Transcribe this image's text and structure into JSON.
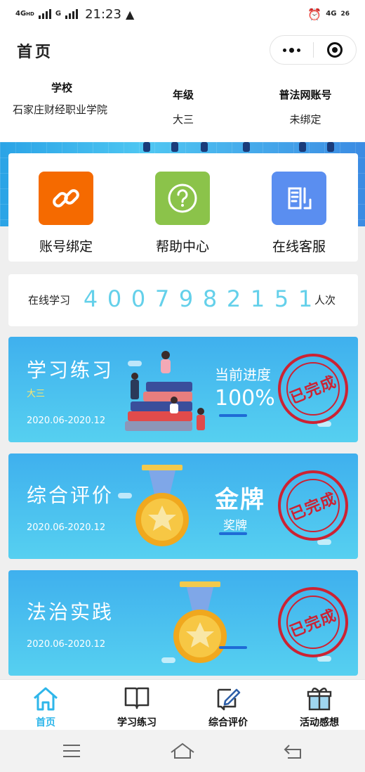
{
  "status": {
    "net_left_1": "4G",
    "net_left_1_sup": "HD",
    "net_left_2": "G",
    "time": "21:23",
    "net_right": "4G",
    "battery": "26"
  },
  "nav": {
    "title": "首页"
  },
  "info": {
    "school_label": "学校",
    "school_value": "石家庄财经职业学院",
    "grade_label": "年级",
    "grade_value": "大三",
    "account_label": "普法网账号",
    "account_value": "未绑定"
  },
  "menu": {
    "bind_label": "账号绑定",
    "help_label": "帮助中心",
    "service_label": "在线客服"
  },
  "counter": {
    "prefix": "在线学习",
    "digits": [
      "4",
      "0",
      "0",
      "7",
      "9",
      "8",
      "2",
      "1",
      "5",
      "1"
    ],
    "suffix": "人次"
  },
  "cards": {
    "study": {
      "title": "学习练习",
      "grade": "大三",
      "date": "2020.06-2020.12",
      "progress_label": "当前进度",
      "progress_value": "100%",
      "stamp": "已完成"
    },
    "eval": {
      "title": "综合评价",
      "date": "2020.06-2020.12",
      "medal": "金牌",
      "medal_sub": "奖牌",
      "stamp": "已完成"
    },
    "law": {
      "title": "法治实践",
      "date": "2020.06-2020.12",
      "stamp": "已完成"
    }
  },
  "tabs": {
    "home": "首页",
    "study": "学习练习",
    "eval": "综合评价",
    "event": "活动感想"
  },
  "colors": {
    "accent": "#2eb6ea",
    "card": "#45b9ee",
    "stamp": "#cc2233",
    "orange": "#f56a00",
    "green": "#8bc34a",
    "blue": "#5a8ef0"
  },
  "icons": {
    "bind": "link-icon",
    "help": "question-circle-icon",
    "service": "headset-document-icon",
    "tab_home": "home-icon",
    "tab_study": "book-icon",
    "tab_eval": "edit-icon",
    "tab_event": "gift-icon"
  }
}
